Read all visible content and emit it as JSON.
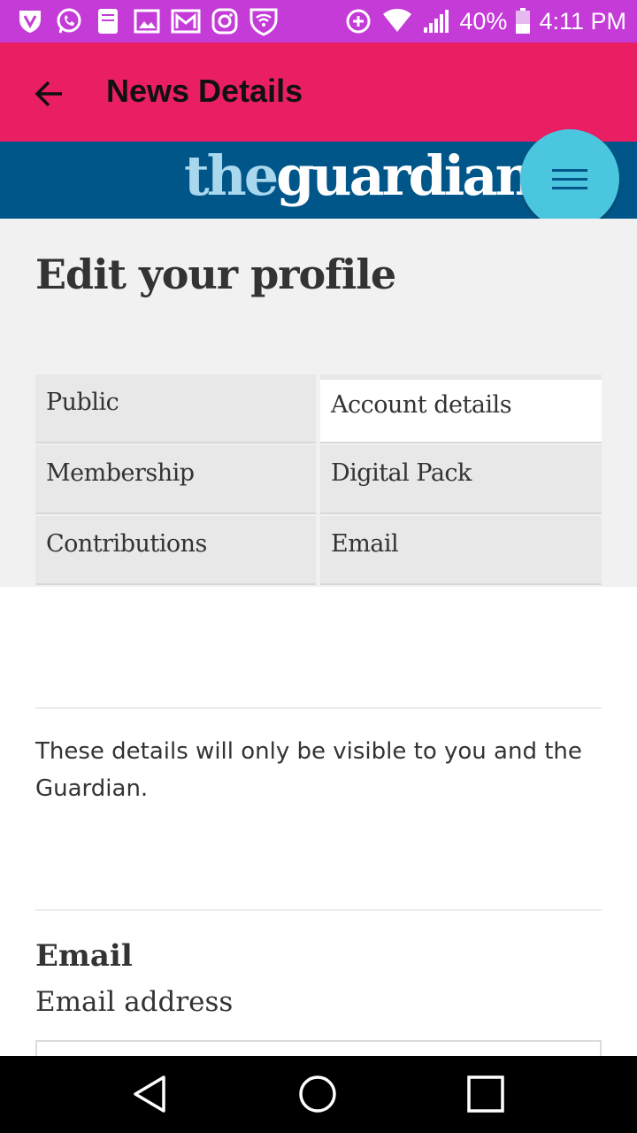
{
  "status_bar": {
    "left_icons": [
      "shield-icon",
      "whatsapp-icon",
      "document-icon",
      "image-icon",
      "gmail-icon",
      "instagram-icon",
      "wifi-shield-icon"
    ],
    "right_icons": [
      "data-saver-icon",
      "wifi-icon",
      "signal-icon",
      "battery-icon"
    ],
    "battery": "40%",
    "time": "4:11 PM",
    "color": "#c43bd8"
  },
  "app_bar": {
    "title": "News Details",
    "back_icon": "arrow-back-icon",
    "color": "#e91e63"
  },
  "guardian": {
    "logo_prefix": "the",
    "logo_main": "guardian",
    "menu_icon": "hamburger-menu-icon",
    "header_color": "#005689",
    "menu_color": "#4bc6df"
  },
  "profile": {
    "title": "Edit your profile",
    "tabs": [
      {
        "label": "Public",
        "active": false
      },
      {
        "label": "Account details",
        "active": true
      },
      {
        "label": "Membership",
        "active": false
      },
      {
        "label": "Digital Pack",
        "active": false
      },
      {
        "label": "Contributions",
        "active": false
      },
      {
        "label": "Email",
        "active": false
      }
    ]
  },
  "details": {
    "info": "These details will only be visible to you and the Guardian.",
    "email_heading": "Email",
    "email_label": "Email address",
    "email_value": ""
  },
  "nav_bar": {
    "back_icon": "nav-back-icon",
    "home_icon": "nav-home-icon",
    "recents_icon": "nav-recents-icon"
  }
}
